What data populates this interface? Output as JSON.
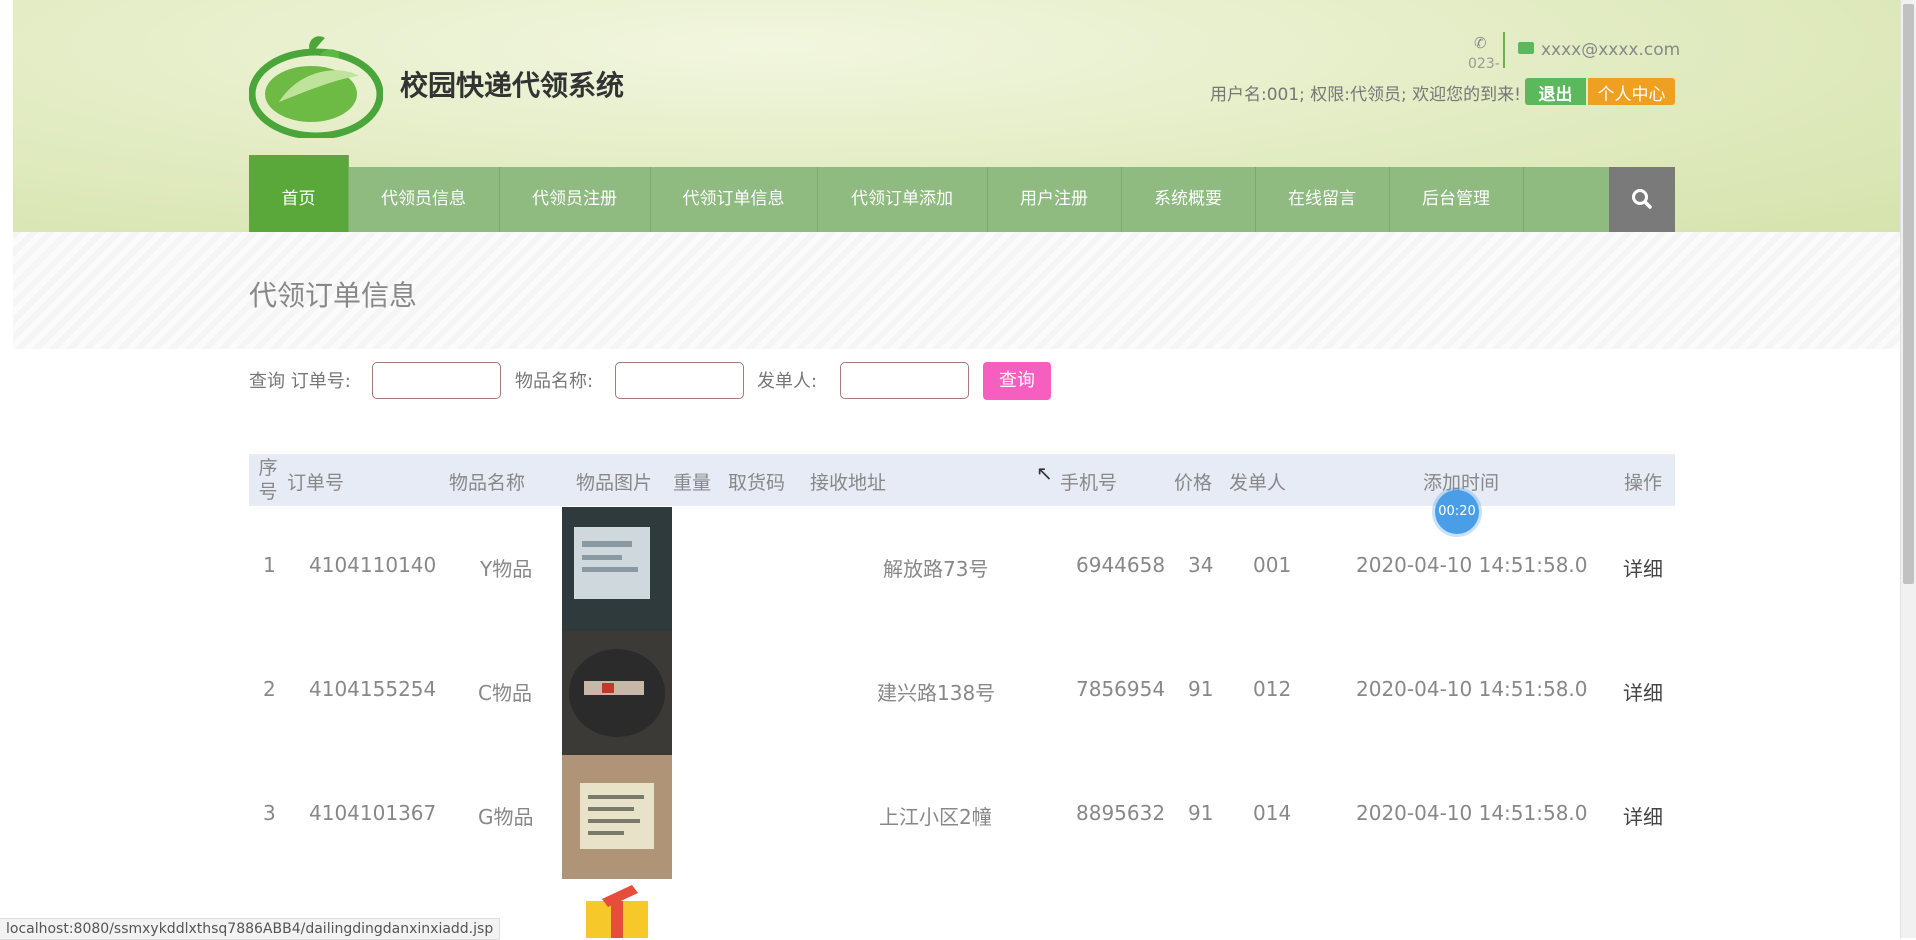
{
  "header": {
    "site_title": "校园快递代领系统",
    "phone": "023-",
    "email": "xxxx@xxxx.com",
    "welcome": "用户名:001; 权限:代领员; 欢迎您的到来!",
    "logout_label": "退出",
    "profile_label": "个人中心"
  },
  "nav": {
    "items": [
      {
        "label": "首页"
      },
      {
        "label": "代领员信息"
      },
      {
        "label": "代领员注册"
      },
      {
        "label": "代领订单信息"
      },
      {
        "label": "代领订单添加"
      },
      {
        "label": "用户注册"
      },
      {
        "label": "系统概要"
      },
      {
        "label": "在线留言"
      },
      {
        "label": "后台管理"
      }
    ],
    "search_icon": "search-icon"
  },
  "page": {
    "title": "代领订单信息"
  },
  "query": {
    "prefix_label": "查询 订单号:",
    "item_name_label": "物品名称:",
    "sender_label": "发单人:",
    "order_value": "",
    "item_value": "",
    "sender_value": "",
    "submit_label": "查询"
  },
  "table": {
    "headers": {
      "seq": "序号",
      "order_no": "订单号",
      "item_name": "物品名称",
      "item_image": "物品图片",
      "weight": "重量",
      "pickup_code": "取货码",
      "address": "接收地址",
      "phone": "手机号",
      "price": "价格",
      "sender": "发单人",
      "added_time": "添加时间",
      "action": "操作"
    },
    "rows": [
      {
        "seq": "1",
        "order_no": "4104110140",
        "item_name": "Y物品",
        "weight": "",
        "pickup_code": "",
        "address": "解放路73号",
        "phone": "6944658",
        "price": "34",
        "sender": "001",
        "added_time": "2020-04-10 14:51:58.0",
        "action": "详细"
      },
      {
        "seq": "2",
        "order_no": "4104155254",
        "item_name": "C物品",
        "weight": "",
        "pickup_code": "",
        "address": "建兴路138号",
        "phone": "7856954",
        "price": "91",
        "sender": "012",
        "added_time": "2020-04-10 14:51:58.0",
        "action": "详细"
      },
      {
        "seq": "3",
        "order_no": "4104101367",
        "item_name": "G物品",
        "weight": "",
        "pickup_code": "",
        "address": "上江小区2幢",
        "phone": "8895632",
        "price": "91",
        "sender": "014",
        "added_time": "2020-04-10 14:51:58.0",
        "action": "详细"
      }
    ]
  },
  "overlay": {
    "timer": "00:20"
  },
  "statusbar": {
    "url": "localhost:8080/ssmxykddlxthsq7886ABB4/dailingdingdanxinxiadd.jsp"
  },
  "colors": {
    "nav_bg": "#8fba80",
    "nav_active": "#5aa83a",
    "query_button": "#f65fbf",
    "logout_button": "#5cb85c",
    "profile_button": "#f0a020"
  }
}
